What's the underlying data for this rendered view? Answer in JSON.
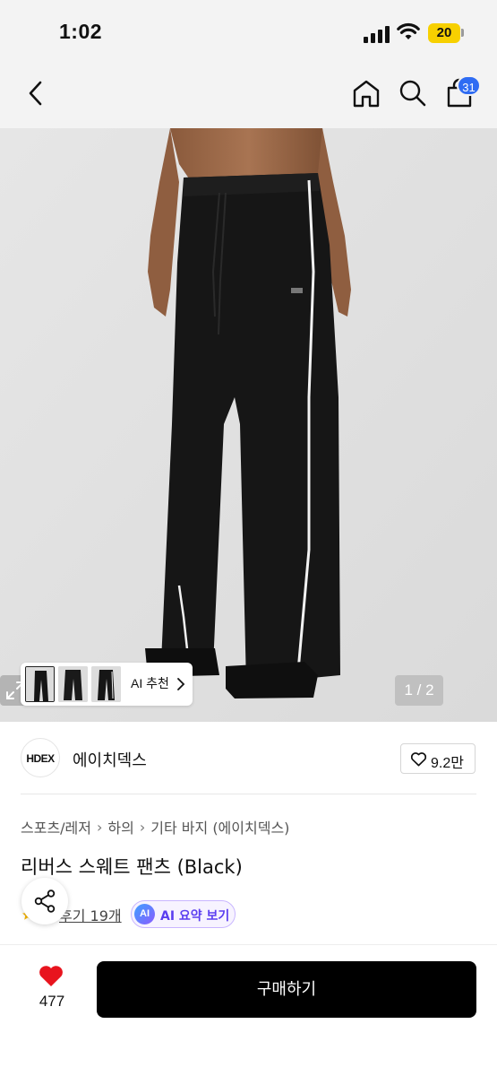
{
  "status_bar": {
    "time": "1:02",
    "battery": "20",
    "battery_color": "#f7d000"
  },
  "nav": {
    "back_icon": "chevron-left-icon",
    "home_icon": "home-icon",
    "search_icon": "search-icon",
    "cart_icon": "shopping-bag-icon",
    "cart_count": "31",
    "badge_color": "#2f6cf3"
  },
  "gallery": {
    "ai_recommend_label": "AI 추천",
    "page_counter": "1 / 2",
    "expand_icon": "expand-icon"
  },
  "brand": {
    "logo_text": "HDEX",
    "name": "에이치덱스",
    "like_count": "9.2만"
  },
  "breadcrumb": [
    "스포츠/레저",
    "하의",
    "기타 바지 (에이치덱스)"
  ],
  "product": {
    "title": "리버스 스웨트 팬츠 (Black)",
    "review_link": "후기 19개",
    "ai_summary_badge": "AI",
    "ai_summary_label": "AI 요약 보기"
  },
  "bottom_bar": {
    "wish_count": "477",
    "wish_color": "#e8141e",
    "buy_label": "구매하기"
  }
}
